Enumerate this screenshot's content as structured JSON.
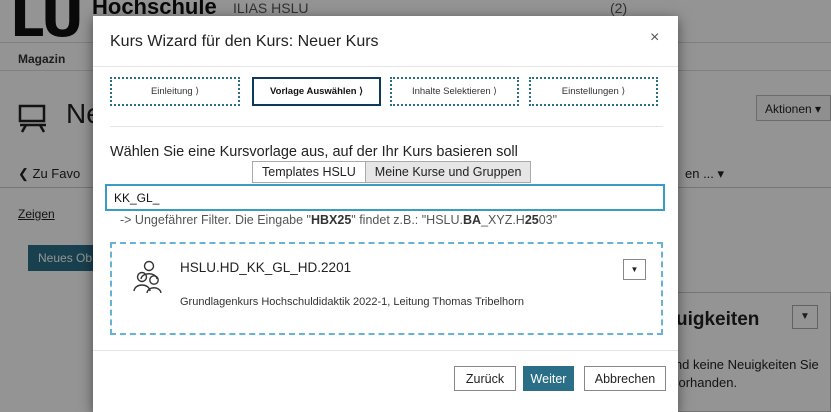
{
  "background": {
    "logo": "LU",
    "org_name": "Hochschule",
    "top_link": "ILIAS HSLU",
    "top_count": "(2)",
    "breadcrumb": "Magazin",
    "course_title_fragment": "Ne",
    "actions_label": "Aktionen ▾",
    "tab_back": "❮ Zu Favo",
    "tab_right": "en     ... ▾",
    "zeigen_label": "Zeigen",
    "new_object_label": "Neues Ob",
    "news_title": "uigkeiten",
    "news_text": "ind keine Neuigkeiten Sie vorhanden."
  },
  "dialog": {
    "title": "Kurs Wizard für den Kurs: Neuer Kurs",
    "close_label": "×",
    "steps": [
      {
        "label": "Einleitung ⟩"
      },
      {
        "label": "Vorlage Auswählen ⟩"
      },
      {
        "label": "Inhalte Selektieren ⟩"
      },
      {
        "label": "Einstellungen ⟩"
      }
    ],
    "prompt": "Wählen Sie eine Kursvorlage aus, auf der Ihr Kurs basieren soll",
    "tabs": [
      {
        "label": "Templates HSLU"
      },
      {
        "label": "Meine Kurse und Gruppen"
      }
    ],
    "search_value": "KK_GL_",
    "hint": {
      "prefix": "-> Ungefährer Filter. Die Eingabe \"",
      "bold1": "HBX25",
      "mid": "\" findet z.B.: \"HSLU.",
      "bold2": "BA",
      "mid2": "_XYZ.H",
      "bold3": "25",
      "suffix": "03\""
    },
    "result": {
      "name": "HSLU.HD_KK_GL_HD.2201",
      "description": "Grundlagenkurs Hochschuldidaktik 2022-1, Leitung Thomas Tribelhorn",
      "toggle": "▼"
    },
    "buttons": {
      "back": "Zurück",
      "next": "Weiter",
      "cancel": "Abbrechen"
    }
  },
  "colors": {
    "accent": "#2a6f87",
    "active_step_border": "#0e3b5c",
    "search_focus": "#3a9cc4",
    "result_dashed": "#67b3d6"
  }
}
